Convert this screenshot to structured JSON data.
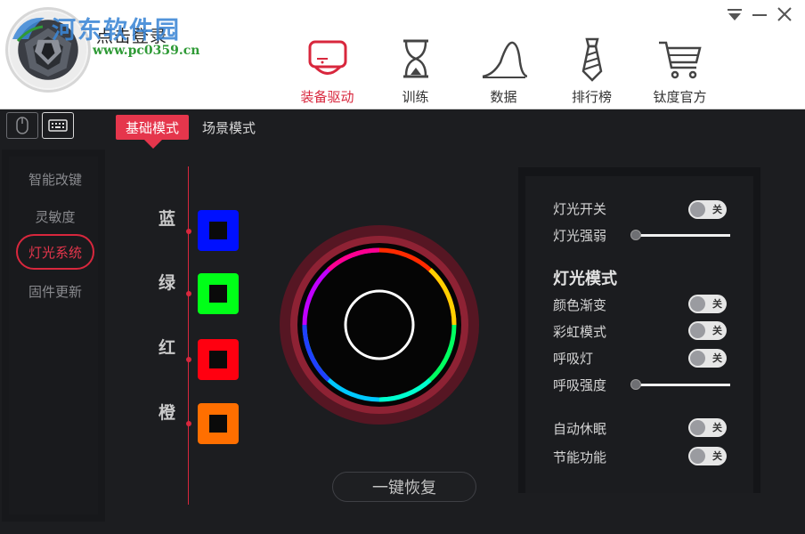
{
  "header": {
    "login_text": "点击登录",
    "watermark_text": "河东软件园",
    "watermark_url": "www.pc0359.cn",
    "nav": [
      {
        "label": "装备驱动",
        "icon": "device-driver-icon",
        "active": true
      },
      {
        "label": "训练",
        "icon": "hourglass-icon",
        "active": false
      },
      {
        "label": "数据",
        "icon": "chart-curve-icon",
        "active": false
      },
      {
        "label": "排行榜",
        "icon": "necktie-icon",
        "active": false
      },
      {
        "label": "钛度官方",
        "icon": "shopping-cart-icon",
        "active": false
      }
    ],
    "window_controls": [
      "dropdown-icon",
      "minimize-icon",
      "close-icon"
    ]
  },
  "device_tabs": [
    {
      "icon": "mouse-icon",
      "active": false
    },
    {
      "icon": "keyboard-icon",
      "active": true
    }
  ],
  "mode_tabs": [
    {
      "label": "基础模式",
      "active": true
    },
    {
      "label": "场景模式",
      "active": false
    }
  ],
  "sidebar": {
    "items": [
      {
        "label": "智能改键",
        "active": false
      },
      {
        "label": "灵敏度",
        "active": false
      },
      {
        "label": "灯光系统",
        "active": true
      },
      {
        "label": "固件更新",
        "active": false
      }
    ]
  },
  "colors": [
    {
      "label": "蓝",
      "color": "#0010ff"
    },
    {
      "label": "绿",
      "color": "#00ff18"
    },
    {
      "label": "红",
      "color": "#ff0010"
    },
    {
      "label": "橙",
      "color": "#ff6f00"
    }
  ],
  "accent_color": "#d8273d",
  "reset_label": "一键恢复",
  "light_panel": {
    "light_switch": {
      "label": "灯光开关",
      "state": "关"
    },
    "light_strength": {
      "label": "灯光强弱",
      "value": 0
    },
    "mode_heading": "灯光模式",
    "color_fade": {
      "label": "颜色渐变",
      "state": "关"
    },
    "rainbow": {
      "label": "彩虹模式",
      "state": "关"
    },
    "breathing": {
      "label": "呼吸灯",
      "state": "关"
    },
    "breathing_strength": {
      "label": "呼吸强度",
      "value": 0
    },
    "auto_sleep": {
      "label": "自动休眠",
      "state": "关"
    },
    "power_save": {
      "label": "节能功能",
      "state": "关"
    }
  }
}
